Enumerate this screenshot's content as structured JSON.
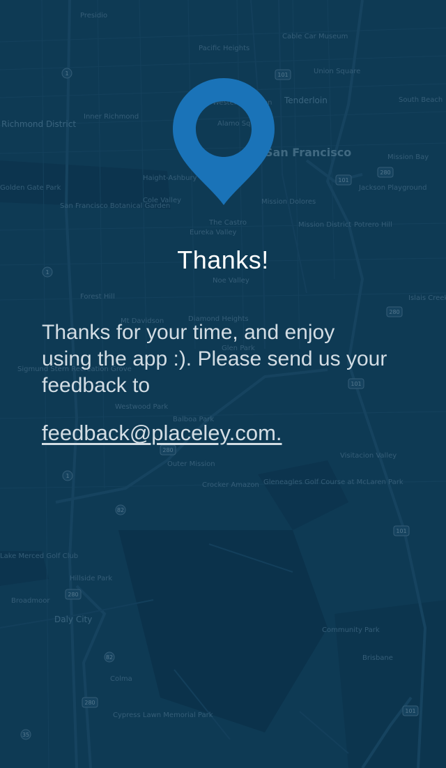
{
  "screen": {
    "title": "Thanks!",
    "message": "Thanks for your time, and enjoy using the app :). Please send us your feedback to",
    "email_link": "feedback@placeley.com.",
    "pin_icon": "location-pin-icon",
    "accent_color": "#1a73b8"
  },
  "map_labels": {
    "presidio": "Presidio",
    "pacific_heights": "Pacific Heights",
    "cable_car_museum": "Cable Car Museum",
    "union_square": "Union Square",
    "richmond_district": "Richmond District",
    "inner_richmond": "Inner Richmond",
    "western_addition": "Western Addition",
    "alamo_square": "Alamo Square",
    "tenderloin": "Tenderloin",
    "san_francisco": "San Francisco",
    "haight_ashbury": "Haight-Ashbury",
    "golden_gate_park": "Golden Gate Park",
    "sf_botanical_garden": "San Francisco Botanical Garden",
    "cole_valley": "Cole Valley",
    "the_castro": "The Castro",
    "eureka_valley": "Eureka Valley",
    "mission_dolores": "Mission Dolores",
    "mission_district": "Mission District",
    "potrero_hill": "Potrero Hill",
    "jackson_playground": "Jackson Playground",
    "noe_valley": "Noe Valley",
    "forest_hill": "Forest Hill",
    "mt_davidson": "Mt Davidson",
    "diamond_heights": "Diamond Heights",
    "glen_park": "Glen Park",
    "sigmund_stern": "Sigmund Stern Recreation Grove",
    "westwood_park": "Westwood Park",
    "balboa_park": "Balboa Park",
    "outer_mission": "Outer Mission",
    "crocker_amazon": "Crocker Amazon",
    "visitacion_valley": "Visitacion Valley",
    "gleneagles": "Gleneagles Golf Course at McLaren Park",
    "lake_merced": "Lake Merced Golf Club",
    "hillside_park": "Hillside Park",
    "broadmoor": "Broadmoor",
    "daly_city": "Daly City",
    "community_park": "Community Park",
    "brisbane": "Brisbane",
    "colma": "Colma",
    "cypress_lawn": "Cypress Lawn Memorial Park",
    "south_beach": "South Beach",
    "mission_bay": "Mission Bay",
    "islais_creek": "Islais Creek",
    "highway_101": "101",
    "highway_280": "280",
    "highway_1": "1",
    "highway_82": "82",
    "highway_35": "35"
  }
}
